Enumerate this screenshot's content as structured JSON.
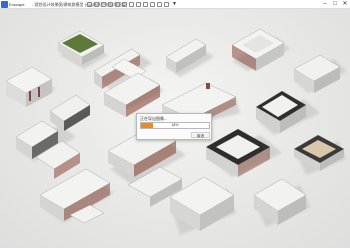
{
  "window": {
    "app_name": "Enscape",
    "title": "- 规划设计效果图/建筑群模型 (SU)场景/白模体块渲染",
    "center_icon": "▼",
    "minimize_icon": "–",
    "maximize_icon": "□",
    "close_icon": "✕"
  },
  "toolbar": {
    "icons": [
      "folder-icon",
      "save-icon",
      "undo-icon",
      "redo-icon",
      "camera-icon",
      "render-icon",
      "video-icon",
      "panorama-icon",
      "settings-icon",
      "asset-icon",
      "sync-icon",
      "view-icon"
    ]
  },
  "dialog": {
    "title": "正在导出图像...",
    "progress": 0.18,
    "progress_text": "18%",
    "cancel_label": "取消"
  },
  "colors": {
    "accent": "#f08a1c",
    "brick": "#8a4b3c",
    "roof_white": "#f1f1ef",
    "dark_roof": "#3a3a3a"
  }
}
